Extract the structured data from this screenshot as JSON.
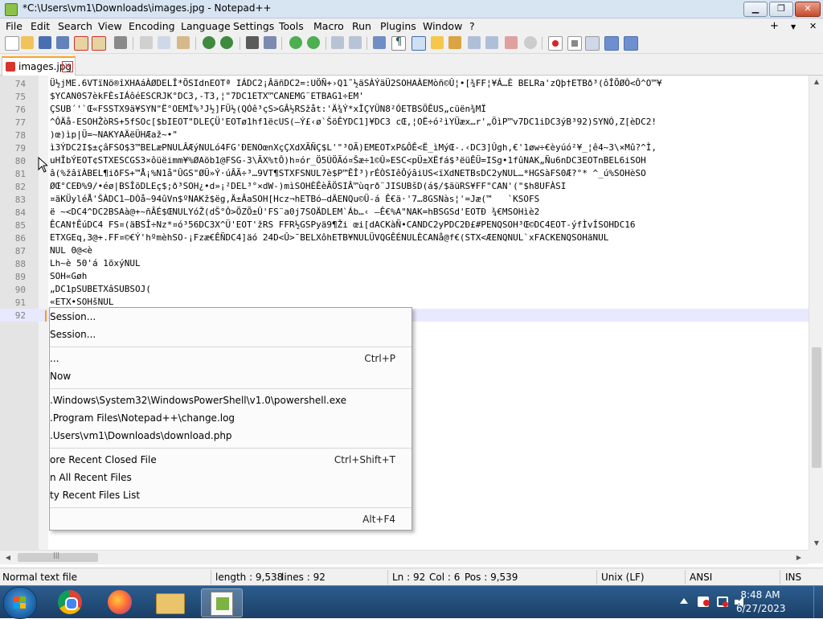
{
  "window": {
    "title": "*C:\\Users\\vm1\\Downloads\\images.jpg - Notepad++",
    "minimize": "▁",
    "maximize": "❐",
    "close": "✕"
  },
  "menu": {
    "items": [
      "File",
      "Edit",
      "Search",
      "View",
      "Encoding",
      "Language",
      "Settings",
      "Tools",
      "Macro",
      "Run",
      "Plugins",
      "Window",
      "?"
    ],
    "add": "+",
    "dropdown_arrow": "▼",
    "close": "✕"
  },
  "toolbar": {
    "icons": [
      "new-file-icon",
      "open-file-icon",
      "save-icon",
      "save-all-icon",
      "close-icon",
      "close-all-icon",
      "print-icon",
      "cut-icon",
      "copy-icon",
      "paste-icon",
      "undo-icon",
      "redo-icon",
      "find-icon",
      "replace-icon",
      "zoom-in-icon",
      "zoom-out-icon",
      "sync-v-icon",
      "sync-h-icon",
      "word-wrap-icon",
      "all-chars-icon",
      "indent-guide-icon",
      "udl-icon",
      "doc-map-icon",
      "function-list-icon",
      "folder-workspace-icon",
      "monitoring-icon",
      "record-macro-icon",
      "stop-macro-icon",
      "play-macro-icon",
      "run-macro-multiple-icon",
      "save-macro-icon"
    ]
  },
  "tab": {
    "name": "images.jpg",
    "close": "✕"
  },
  "editor": {
    "lines": [
      {
        "n": "74",
        "text": "Ü½jME.6VTïNö®îXHAáÀØDELÎ*ÖSIdnEOTª IÁDC2¡ÂäñDC2=:UÖÑ+›Q1˜½äSÀÝäÜ2SOHAÀEMòñ©Û¦•[¾FF¦¥Á…È BELRa'zQþ†ETBð³(ôÎÕØÒ<Ô^O™¥"
      },
      {
        "n": "75",
        "text": "$YCAN0S7èkFÈsIÁôéESCRJK°DC3,-T3,¦\"7DC1ETX™CANEMG¨ETBAG1÷EM'"
      },
      {
        "n": "76",
        "text": "ÇSUB´'`Œ«FSSTX9ä¥SYN\"Ë°OEMÏ%³J½]FÜ½(QÓê³çS>GÂ½RSžåt:'Ä¾Ý*xÎÇYÜN8²ÓETBSÖÊUS„cüën¾MÏ"
      },
      {
        "n": "77",
        "text": "^ÔÄå-ESOHŽòRS+5fSOc[$bIEOT\"DLEÇÜ'EOTø1hf1ëcUS(–Ý£‹ø`ŠöÊYDC1]¥DC3 cŒ,¦OË÷ó²ìYÜæx…r'„ÖìP™v7DC1iDC3ýB³92)SYNÓ,Z[èDC2!"
      },
      {
        "n": "78",
        "text": ")œ)ìp|Ü=~NAKYAÄëÜHÆaž~•\""
      },
      {
        "n": "79",
        "text": "ì3ÝDC2I$±çâFSO$3™BELæPNULÂÆýNULó4FG'ÐENOœnXçÇXdXÃÑÇ$L'\"³OÃ)EMEOTxP&ÔÊ<Ë_ìMýŒ-.‹DC3]Ûgh,€'1øw÷€èyúó²¥_¦ê4~3\\×Mû?^Ì,"
      },
      {
        "n": "80",
        "text": "uHÎbÝEOT¢STXESCGS3×ôüëimm¥%ØAöb1@FSG-3\\ÃX%tÔ)h¤ór_Ö5ÚÖÃó¤Šæ÷1©Û»ESC<pÜ±XËfá$³ëüÊÜ=ISg•1fûNAK„Ñu6nDC3EOTnBEL6iSOH"
      },
      {
        "n": "81",
        "text": "â(%žâïÀBEL¶iðFS+™Å¡%N1å\"ÛGS\"ØÜ»Ý·úÂÃ÷³…9VT¶STXFSNUL7è$P™ÊÎ³)rÉÒSIêÔýâiUS<ïXdNETBsDC2yNUL…*HGSàFS0Æ?°* ^_ú%SOHèSO"
      },
      {
        "n": "82",
        "text": "ØŒ°CEÐ%9/•éø|BSÎõDLEç$;ð³SOH¿•d»¡²DEL³°×dW-)mìSOHÈÊèÃÖSIÂ™ùqrð¨JISUBšD(á$/$ãüRS¥FF\"CAN'(\"$h8UFÀSI"
      },
      {
        "n": "83",
        "text": "¤äKÜyléÅ'ŠÀDC1—DÒå~94ûVn$ºNAKž$ëg,Ä±ÂaSOH[Hcz¬hETBó—dÄENQu©Ü-á Ê€ä·'7…8GSNàs¦'=Jæ(™   `KSOFS"
      },
      {
        "n": "84",
        "text": "ë ~<DC4^DC2BSAà@+~ñÂÉ$ŒNULYóŽ(dŠ°Ô>ÕZÕ±Û'FS¨a0j7SOÄDLEM`Áb…‹ –Ê€%A\"NAK=hBSGSd'EOTÐ ¾€MSOHìè2"
      },
      {
        "n": "85",
        "text": "ÊCAN†ÊúDC4 FS¤(äBSÎ÷Nz*¤ó³56DC3X^Ü'EOT'žRS FFR½GSPyä9¶Ži œi[dACKàÑ•CANDC2yPDC2Ð£#PENQSOH³Œ©DC4EOT-ýfÌvÍSOHDC16"
      },
      {
        "n": "86",
        "text": "ETXGEq,3@+.FF¤©€Ý'hºmèhSO-¡Fzæ€ÊÑDC4]äó 24D<Û>¯BELXôhETB¥NULÜVQGÊÉNULÈCANå@f€(STX<ÆENQNUL`xFACKENQSOHãNUL"
      },
      {
        "n": "87",
        "text": "NUL 0@<è"
      },
      {
        "n": "88",
        "text": "Lh~è 50'á 1õxýNUL"
      },
      {
        "n": "89",
        "text": "SOH«Gøh"
      },
      {
        "n": "90",
        "text": "„DC1pSUBETXâSUBSOJ("
      },
      {
        "n": "91",
        "text": "«ETX•SOHšNUL"
      },
      {
        "n": "92",
        "text": ""
      }
    ]
  },
  "file_menu": {
    "items": [
      {
        "label": "Session...",
        "shortcut": ""
      },
      {
        "label": "Session...",
        "shortcut": ""
      },
      {
        "label": "...",
        "shortcut": "Ctrl+P"
      },
      {
        "label": "Now",
        "shortcut": ""
      },
      {
        "label": ".Windows\\System32\\WindowsPowerShell\\v1.0\\powershell.exe",
        "shortcut": ""
      },
      {
        "label": ".Program Files\\Notepad++\\change.log",
        "shortcut": ""
      },
      {
        "label": ".Users\\vm1\\Downloads\\download.php",
        "shortcut": ""
      },
      {
        "label": "ore Recent Closed File",
        "shortcut": "Ctrl+Shift+T"
      },
      {
        "label": "n All Recent Files",
        "shortcut": ""
      },
      {
        "label": "ty Recent Files List",
        "shortcut": ""
      },
      {
        "label": "",
        "shortcut": "Alt+F4"
      }
    ]
  },
  "scrollbar": {
    "up": "▲",
    "down": "▼",
    "left": "◀",
    "right": "▶",
    "grip": "|||"
  },
  "status": {
    "type": "Normal text file",
    "length": "length : 9,538",
    "lines": "lines : 92",
    "ln": "Ln : 92",
    "col": "Col : 6",
    "pos": "Pos : 9,539",
    "eol": "Unix (LF)",
    "encoding": "ANSI",
    "mode": "INS"
  },
  "taskbar": {
    "apps": [
      "chrome-icon",
      "firefox-icon",
      "file-explorer-icon",
      "notepad-plus-plus-icon"
    ],
    "tray": [
      "show-hidden-icons-icon",
      "action-center-icon",
      "network-icon",
      "volume-icon"
    ],
    "time": "8:48 AM",
    "date": "6/27/2023"
  }
}
